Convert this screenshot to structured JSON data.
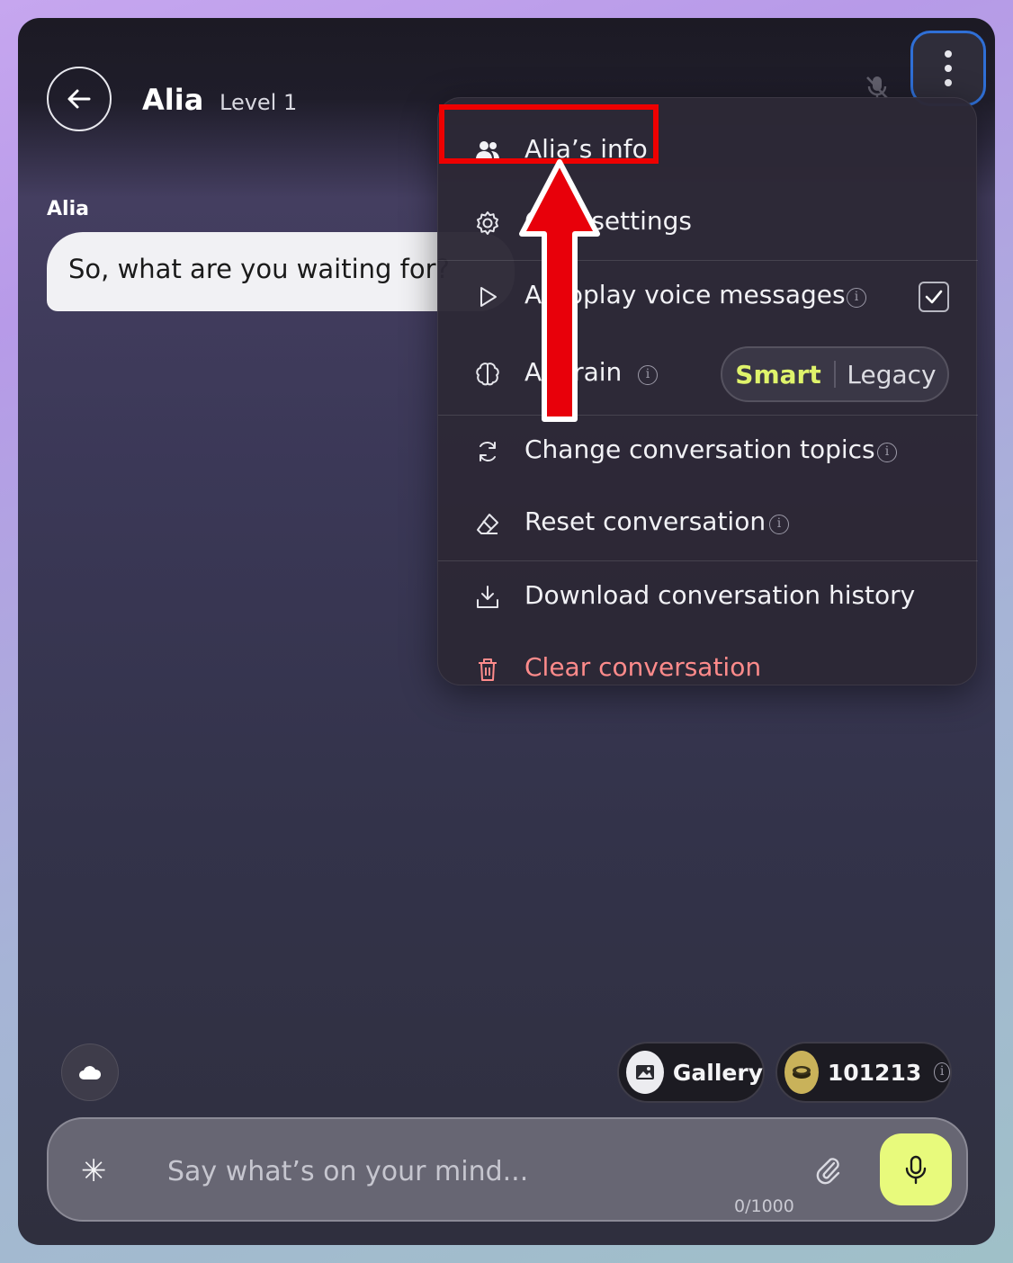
{
  "header": {
    "name": "Alia",
    "level": "Level 1"
  },
  "chat": {
    "sender": "Alia",
    "message": "So, what are you waiting for?"
  },
  "menu": {
    "items": {
      "info": "Alia’s info",
      "chat_settings": "Chat settings",
      "autoplay": "Autoplay voice messages",
      "ai_brain": "AI brain",
      "change_topics": "Change conversation topics",
      "reset": "Reset conversation",
      "download": "Download conversation history",
      "clear": "Clear conversation"
    },
    "autoplay_checked": true,
    "brain_options": [
      "Smart",
      "Legacy"
    ],
    "brain_selected": "Smart",
    "info_glyph": "i"
  },
  "footer": {
    "gallery_label": "Gallery",
    "coins": "101213",
    "placeholder": "Say what’s on your mind...",
    "counter": "0/1000",
    "star_glyph": "✳"
  },
  "colors": {
    "accent_lime": "#e8fa7c",
    "smart_text": "#dff36b",
    "danger": "#ff8b8b",
    "highlight": "#ee0000",
    "focus_ring": "#2f6fd6"
  }
}
